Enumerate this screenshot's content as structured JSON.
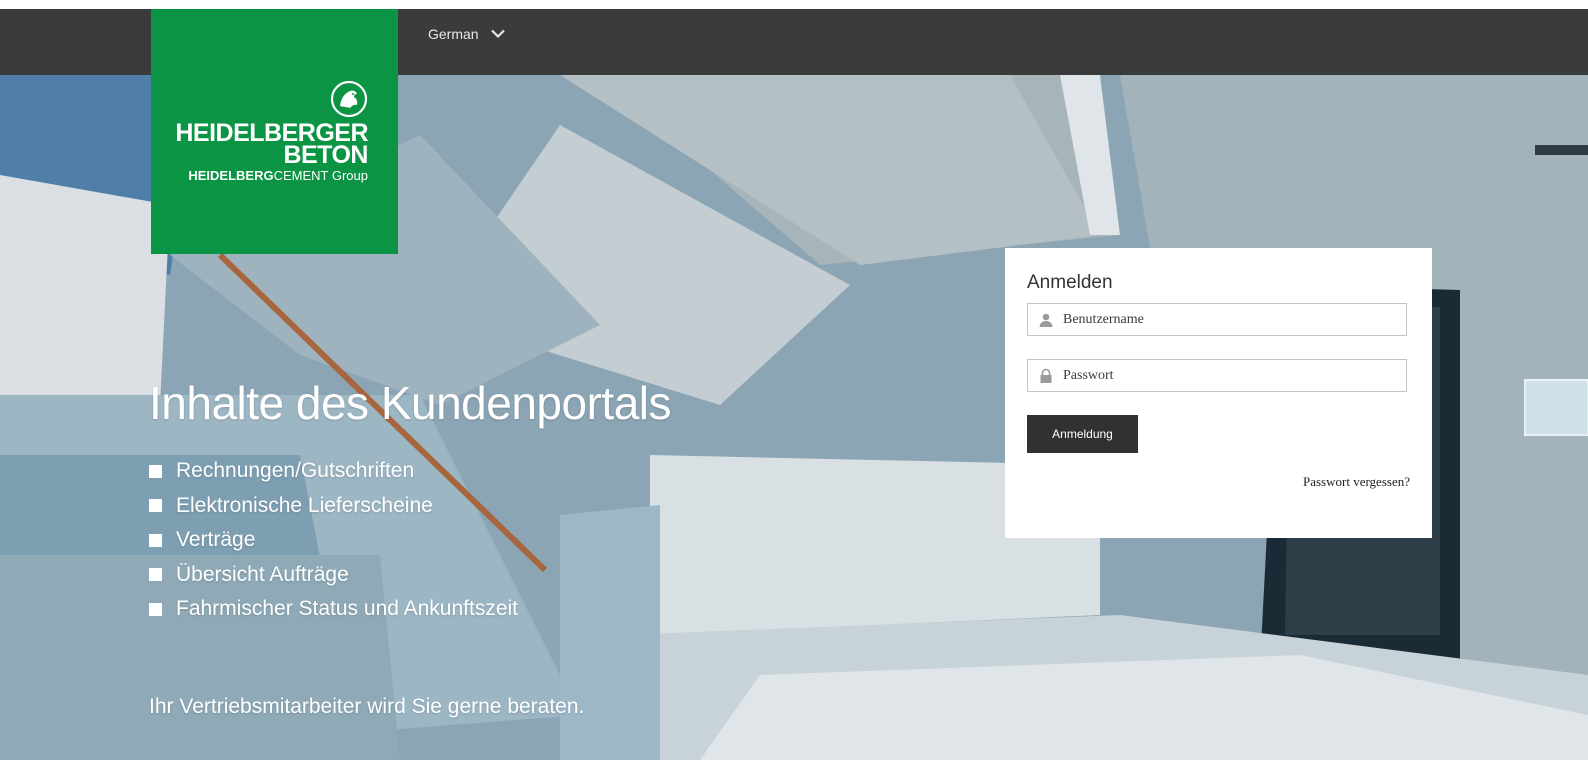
{
  "header": {
    "language": "German",
    "language_icon": "chevron-down-icon"
  },
  "logo": {
    "emblem_icon": "heidelberger-lion-emblem",
    "line1": "HEIDELBERGER",
    "line2": "BETON",
    "group_bold": "HEIDELBERG",
    "group_regular": "CEMENT Group",
    "color": "#0b9444"
  },
  "hero": {
    "title": "Inhalte des Kundenportals",
    "features": [
      "Rechnungen/Gutschriften",
      "Elektronische Lieferscheine",
      "Verträge",
      "Übersicht Aufträge",
      "Fahrmischer Status und Ankunftszeit"
    ],
    "note": "Ihr Vertriebsmitarbeiter wird Sie gerne beraten."
  },
  "login": {
    "title": "Anmelden",
    "username_placeholder": "Benutzername",
    "username_icon": "user-icon",
    "password_placeholder": "Passwort",
    "password_icon": "lock-icon",
    "submit_label": "Anmeldung",
    "forgot_label": "Passwort vergessen?"
  },
  "colors": {
    "header": "#3a3b3c",
    "button": "#2f3133",
    "brand_green": "#0b9444"
  }
}
